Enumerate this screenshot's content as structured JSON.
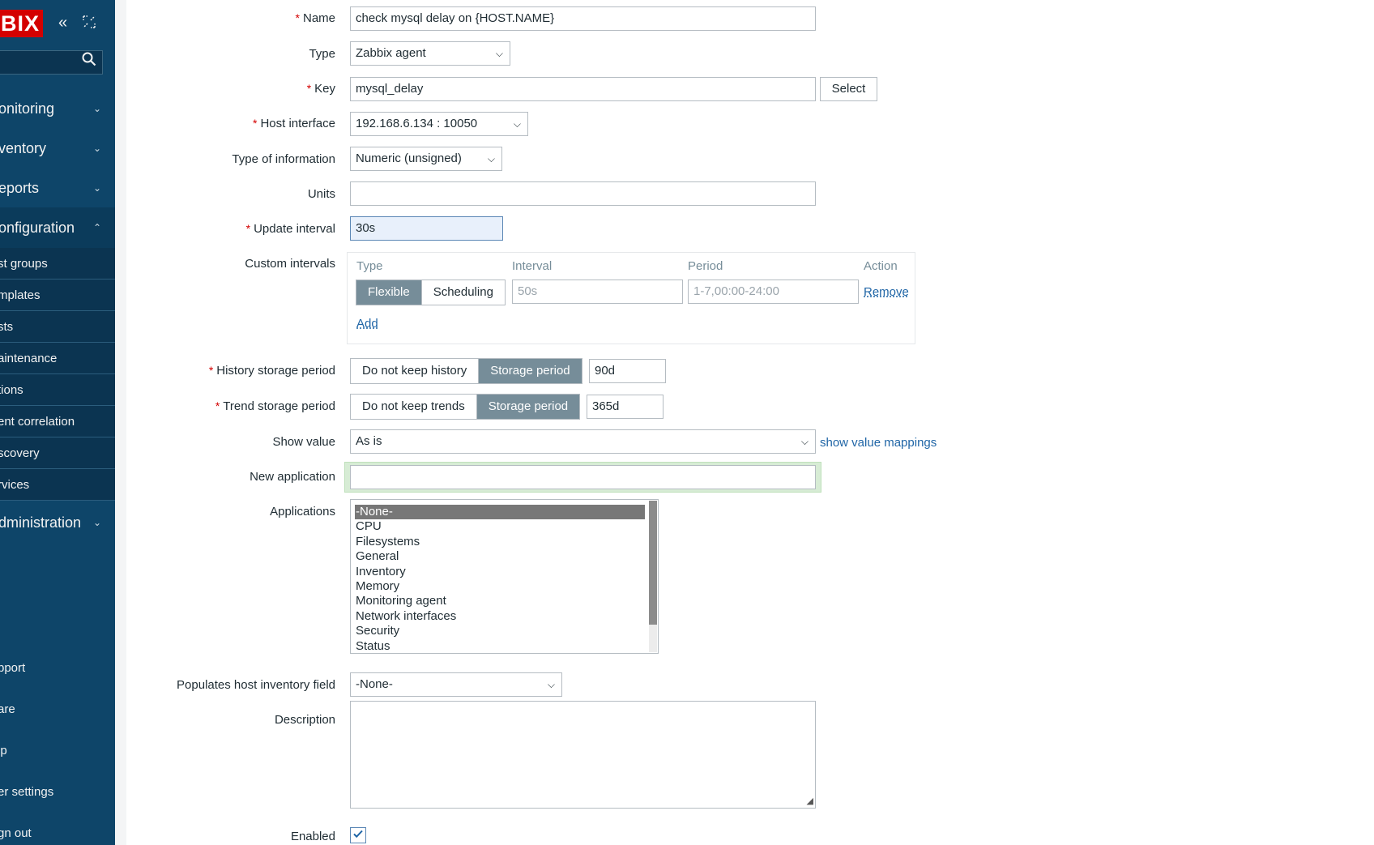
{
  "sidebar": {
    "logo": "BIX",
    "collapse_icon": "double-chevron-left-icon",
    "kiosk_icon": "kiosk-mode-icon",
    "search_icon": "search-icon",
    "menu": [
      {
        "label": "onitoring",
        "chevron": "⌄"
      },
      {
        "label": "ventory",
        "chevron": "⌄"
      },
      {
        "label": "eports",
        "chevron": "⌄"
      },
      {
        "label": "onfiguration",
        "chevron": "⌃"
      }
    ],
    "submenu": [
      "st groups",
      "mplates",
      "sts",
      "aintenance",
      "tions",
      "ent correlation",
      "scovery",
      "rvices"
    ],
    "administration": {
      "label": "dministration",
      "chevron": "⌄"
    },
    "footer": [
      "pport",
      "are",
      "lp",
      "er settings",
      "gn out"
    ]
  },
  "form": {
    "name": {
      "label": "Name",
      "value": "check mysql delay on {HOST.NAME}"
    },
    "type": {
      "label": "Type",
      "value": "Zabbix agent"
    },
    "key": {
      "label": "Key",
      "value": "mysql_delay",
      "button": "Select"
    },
    "host_interface": {
      "label": "Host interface",
      "value": "192.168.6.134 : 10050"
    },
    "type_of_information": {
      "label": "Type of information",
      "value": "Numeric (unsigned)"
    },
    "units": {
      "label": "Units",
      "value": ""
    },
    "update_interval": {
      "label": "Update interval",
      "value": "30s"
    },
    "custom_intervals": {
      "label": "Custom intervals",
      "headers": [
        "Type",
        "Interval",
        "Period",
        "Action"
      ],
      "type_options": [
        "Flexible",
        "Scheduling"
      ],
      "interval_placeholder": "50s",
      "period_placeholder": "1-7,00:00-24:00",
      "remove": "Remove",
      "add": "Add"
    },
    "history": {
      "label": "History storage period",
      "options": [
        "Do not keep history",
        "Storage period"
      ],
      "value": "90d"
    },
    "trend": {
      "label": "Trend storage period",
      "options": [
        "Do not keep trends",
        "Storage period"
      ],
      "value": "365d"
    },
    "show_value": {
      "label": "Show value",
      "value": "As is",
      "link": "show value mappings"
    },
    "new_application": {
      "label": "New application",
      "value": ""
    },
    "applications": {
      "label": "Applications",
      "options": [
        "-None-",
        "CPU",
        "Filesystems",
        "General",
        "Inventory",
        "Memory",
        "Monitoring agent",
        "Network interfaces",
        "Security",
        "Status"
      ],
      "selected": "-None-"
    },
    "inventory_field": {
      "label": "Populates host inventory field",
      "value": "-None-"
    },
    "description": {
      "label": "Description",
      "value": ""
    },
    "enabled": {
      "label": "Enabled",
      "checked": true
    }
  }
}
